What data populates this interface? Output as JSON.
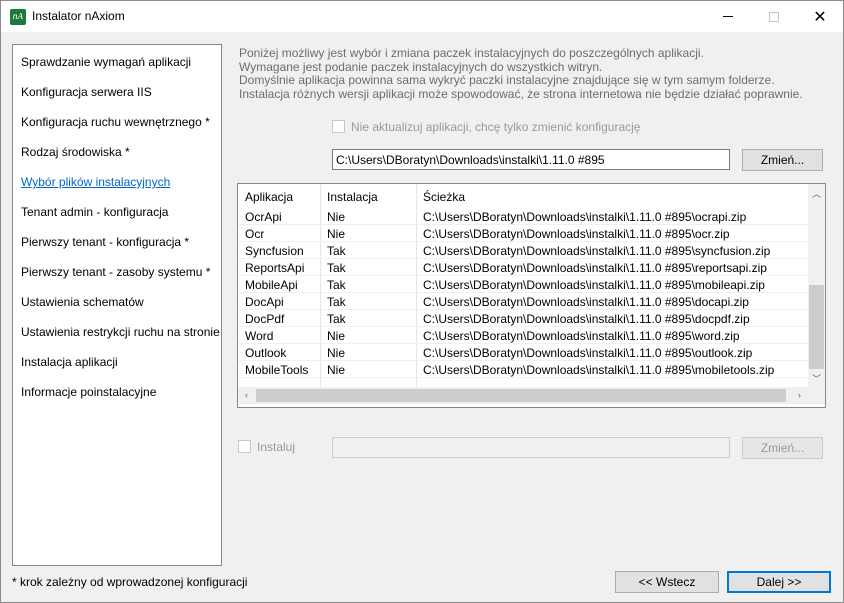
{
  "window": {
    "title": "Instalator nAxiom",
    "icon_text": "nA"
  },
  "sidebar": {
    "items": [
      {
        "label": "Sprawdzanie wymagań aplikacji"
      },
      {
        "label": "Konfiguracja serwera IIS"
      },
      {
        "label": "Konfiguracja ruchu wewnętrznego *"
      },
      {
        "label": "Rodzaj środowiska *"
      },
      {
        "label": "Wybór plików instalacyjnych",
        "active": true
      },
      {
        "label": "Tenant admin - konfiguracja"
      },
      {
        "label": "Pierwszy tenant - konfiguracja *"
      },
      {
        "label": "Pierwszy tenant - zasoby systemu *"
      },
      {
        "label": "Ustawienia schematów"
      },
      {
        "label": "Ustawienia restrykcji ruchu na stronie"
      },
      {
        "label": "Instalacja aplikacji"
      },
      {
        "label": "Informacje poinstalacyjne"
      }
    ],
    "footnote": "* krok zależny od wprowadzonej konfiguracji"
  },
  "info": {
    "line1": "Poniżej możliwy jest wybór i zmiana paczek instalacyjnych do poszczególnych aplikacji.",
    "line2": "Wymagane jest podanie paczek instalacyjnych do wszystkich witryn.",
    "line3": "Domyślnie aplikacja powinna sama wykryć paczki instalacyjne znajdujące się w tym samym folderze.",
    "line4": "Instalacja różnych wersji aplikacji może spowodować, że strona internetowa nie będzie działać poprawnie."
  },
  "no_update": {
    "label": "Nie aktualizuj aplikacji, chcę tylko zmienić konfigurację",
    "checked": false
  },
  "path": {
    "value": "C:\\Users\\DBoratyn\\Downloads\\instalki\\1.11.0 #895",
    "change_label": "Zmień..."
  },
  "table": {
    "headers": [
      "Aplikacja",
      "Instalacja",
      "Ścieżka"
    ],
    "rows": [
      [
        "OcrApi",
        "Nie",
        "C:\\Users\\DBoratyn\\Downloads\\instalki\\1.11.0 #895\\ocrapi.zip"
      ],
      [
        "Ocr",
        "Nie",
        "C:\\Users\\DBoratyn\\Downloads\\instalki\\1.11.0 #895\\ocr.zip"
      ],
      [
        "Syncfusion",
        "Tak",
        "C:\\Users\\DBoratyn\\Downloads\\instalki\\1.11.0 #895\\syncfusion.zip"
      ],
      [
        "ReportsApi",
        "Tak",
        "C:\\Users\\DBoratyn\\Downloads\\instalki\\1.11.0 #895\\reportsapi.zip"
      ],
      [
        "MobileApi",
        "Tak",
        "C:\\Users\\DBoratyn\\Downloads\\instalki\\1.11.0 #895\\mobileapi.zip"
      ],
      [
        "DocApi",
        "Tak",
        "C:\\Users\\DBoratyn\\Downloads\\instalki\\1.11.0 #895\\docapi.zip"
      ],
      [
        "DocPdf",
        "Tak",
        "C:\\Users\\DBoratyn\\Downloads\\instalki\\1.11.0 #895\\docpdf.zip"
      ],
      [
        "Word",
        "Nie",
        "C:\\Users\\DBoratyn\\Downloads\\instalki\\1.11.0 #895\\word.zip"
      ],
      [
        "Outlook",
        "Nie",
        "C:\\Users\\DBoratyn\\Downloads\\instalki\\1.11.0 #895\\outlook.zip"
      ],
      [
        "MobileTools",
        "Nie",
        "C:\\Users\\DBoratyn\\Downloads\\instalki\\1.11.0 #895\\mobiletools.zip"
      ]
    ]
  },
  "install": {
    "label": "Instaluj",
    "checked": false,
    "value": "",
    "change_label": "Zmień..."
  },
  "nav": {
    "back_label": "<< Wstecz",
    "next_label": "Dalej >>"
  }
}
